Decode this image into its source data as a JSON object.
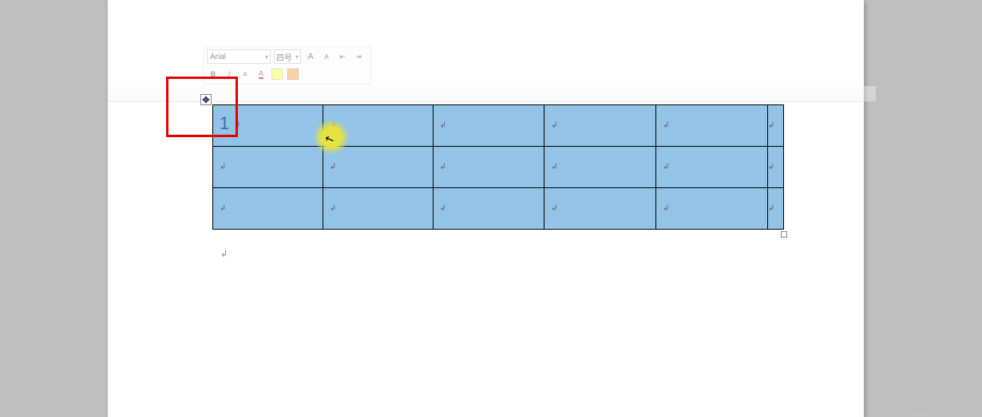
{
  "mini_toolbar": {
    "font_name": "Arial",
    "font_size": "四号",
    "grow_font": "A",
    "shrink_font": "A",
    "indent_decrease": "⇤",
    "indent_increase": "⇥",
    "bold": "B",
    "italic": "I",
    "align": "≡",
    "font_color_label": "A",
    "highlight_label": "",
    "fill_label": ""
  },
  "table": {
    "first_cell_number": "1",
    "para_mark": "↲"
  },
  "move_handle_glyph": "✥",
  "after_para_mark": "↲",
  "cursor_glyph": "↖",
  "watermark": "www.wzjsgs.com"
}
